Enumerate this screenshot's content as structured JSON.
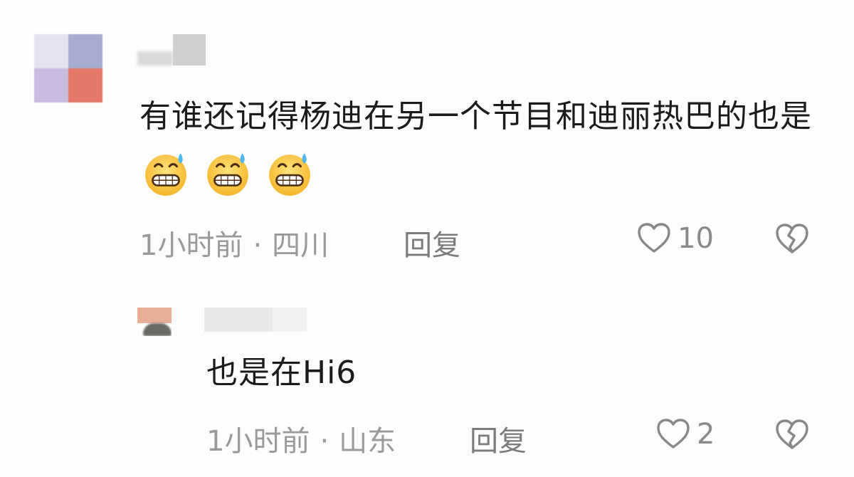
{
  "comments": [
    {
      "text": "有谁还记得杨迪在另一个节目和迪丽热巴的也是",
      "emoji_icons": [
        "sweat-grin-emoji-icon",
        "sweat-grin-emoji-icon",
        "sweat-grin-emoji-icon"
      ],
      "time": "1小时前",
      "separator": "·",
      "location": "四川",
      "reply_label": "回复",
      "likes": "10"
    }
  ],
  "replies": [
    {
      "text": "也是在Hi6",
      "time": "1小时前",
      "separator": "·",
      "location": "山东",
      "reply_label": "回复",
      "likes": "2"
    }
  ],
  "colors": {
    "text": "#1b1b1b",
    "meta": "#9a9a9a",
    "reply": "#7b7b7b",
    "icon": "#888888",
    "background": "#fdfdfb"
  },
  "icons": {
    "like": "heart-outline-icon",
    "dislike": "broken-heart-icon"
  }
}
